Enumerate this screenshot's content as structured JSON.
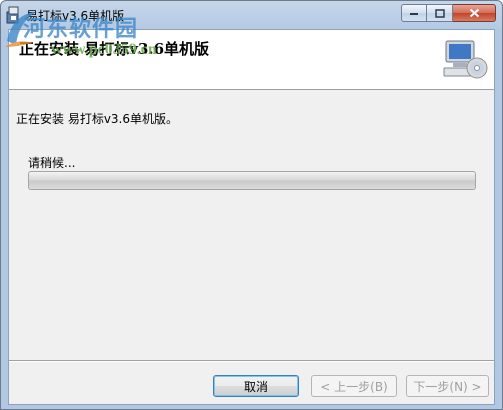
{
  "window": {
    "title": "易打标v3.6单机版"
  },
  "header": {
    "title": "正在安装 易打标v3.6单机版"
  },
  "watermark": {
    "logo_text": "河东软件园",
    "url": "www.pc0359.cn"
  },
  "body": {
    "install_message": "正在安装 易打标v3.6单机版。",
    "wait_label": "请稍候...",
    "progress_fraction": 0
  },
  "buttons": {
    "cancel": "取消",
    "back": "< 上一步(B)",
    "next": "下一步(N) >"
  },
  "colors": {
    "title_bar": "#b2c8e2",
    "client_bg": "#f0f0f0",
    "watermark_blue": "#3d87c8",
    "watermark_green": "#6aa84f"
  }
}
